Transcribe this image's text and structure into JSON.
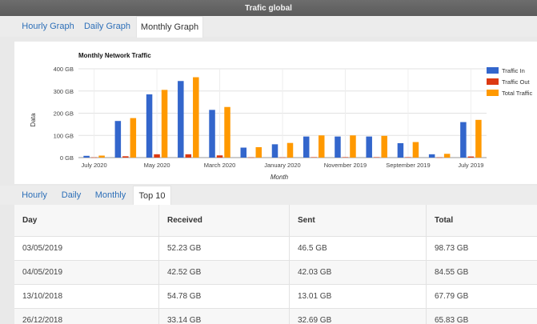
{
  "window": {
    "title": "Trafic global"
  },
  "top_tabs": [
    {
      "label": "Hourly Graph",
      "active": false
    },
    {
      "label": "Daily Graph",
      "active": false
    },
    {
      "label": "Monthly Graph",
      "active": true
    }
  ],
  "chart_data": {
    "type": "bar",
    "title": "Monthly Network Traffic",
    "xlabel": "Month",
    "ylabel": "Data",
    "ylim": [
      0,
      400
    ],
    "yticks": [
      "0 GB",
      "100 GB",
      "200 GB",
      "300 GB",
      "400 GB"
    ],
    "x_tick_labels": [
      "July 2020",
      "May 2020",
      "March 2020",
      "January 2020",
      "November 2019",
      "September 2019",
      "July 2019"
    ],
    "legend_position": "right",
    "grid": true,
    "series": [
      {
        "name": "Traffic In",
        "color": "#3366cc",
        "values": [
          8,
          165,
          285,
          345,
          215,
          45,
          60,
          95,
          95,
          95,
          65,
          15,
          160
        ]
      },
      {
        "name": "Traffic Out",
        "color": "#dc3912",
        "values": [
          1,
          6,
          15,
          15,
          10,
          1,
          1,
          2,
          2,
          2,
          2,
          1,
          5
        ]
      },
      {
        "name": "Total Traffic",
        "color": "#ff9900",
        "values": [
          9,
          178,
          305,
          362,
          228,
          47,
          66,
          100,
          100,
          98,
          70,
          17,
          170
        ]
      }
    ]
  },
  "bottom_tabs": [
    {
      "label": "Hourly",
      "active": false
    },
    {
      "label": "Daily",
      "active": false
    },
    {
      "label": "Monthly",
      "active": false
    },
    {
      "label": "Top 10",
      "active": true
    }
  ],
  "table": {
    "headers": [
      "Day",
      "Received",
      "Sent",
      "Total"
    ],
    "rows": [
      [
        "03/05/2019",
        "52.23 GB",
        "46.5 GB",
        "98.73 GB"
      ],
      [
        "04/05/2019",
        "42.52 GB",
        "42.03 GB",
        "84.55 GB"
      ],
      [
        "13/10/2018",
        "54.78 GB",
        "13.01 GB",
        "67.79 GB"
      ],
      [
        "26/12/2018",
        "33.14 GB",
        "32.69 GB",
        "65.83 GB"
      ]
    ]
  }
}
